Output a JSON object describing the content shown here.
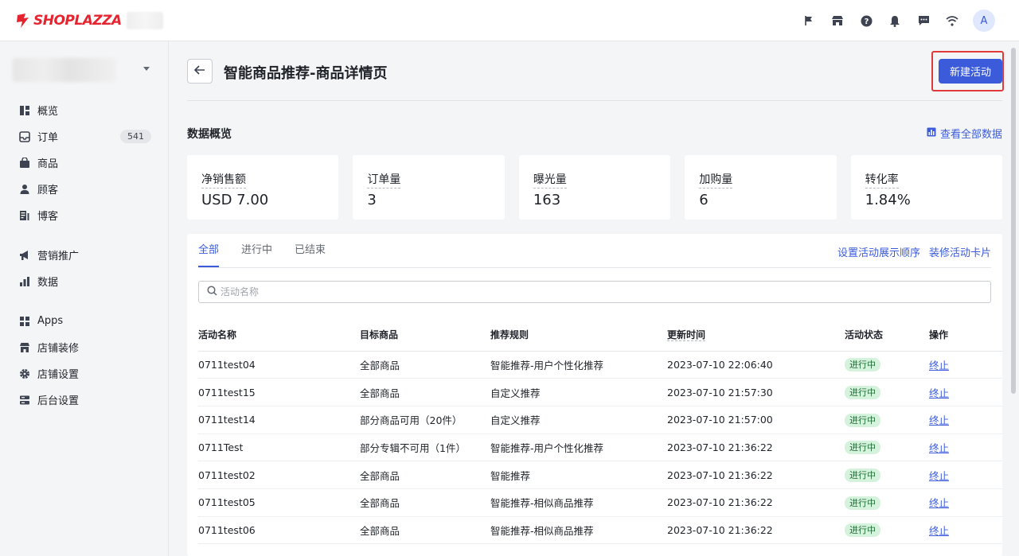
{
  "brand": {
    "name": "SHOPLAZZA",
    "color": "#e5242f"
  },
  "topbar": {
    "icons": [
      "flag-icon",
      "store-icon",
      "help-icon",
      "bell-icon",
      "message-icon",
      "wifi-icon"
    ],
    "avatar_letter": "A"
  },
  "sidebar": {
    "groups": [
      [
        {
          "icon": "overview-icon",
          "label": "概览"
        },
        {
          "icon": "order-icon",
          "label": "订单",
          "badge": "541"
        },
        {
          "icon": "product-icon",
          "label": "商品"
        },
        {
          "icon": "customer-icon",
          "label": "顾客"
        },
        {
          "icon": "blog-icon",
          "label": "博客"
        }
      ],
      [
        {
          "icon": "megaphone-icon",
          "label": "营销推广"
        },
        {
          "icon": "chart-icon",
          "label": "数据"
        }
      ],
      [
        {
          "icon": "apps-icon",
          "label": "Apps"
        },
        {
          "icon": "store-decor-icon",
          "label": "店铺装修"
        },
        {
          "icon": "gear-icon",
          "label": "店铺设置"
        },
        {
          "icon": "server-icon",
          "label": "后台设置"
        }
      ]
    ]
  },
  "header": {
    "title": "智能商品推荐-商品详情页",
    "new_button": "新建活动"
  },
  "overview": {
    "title": "数据概览",
    "view_all": "查看全部数据",
    "cards": [
      {
        "label": "净销售额",
        "value": "USD 7.00"
      },
      {
        "label": "订单量",
        "value": "3"
      },
      {
        "label": "曝光量",
        "value": "163"
      },
      {
        "label": "加购量",
        "value": "6"
      },
      {
        "label": "转化率",
        "value": "1.84%"
      }
    ]
  },
  "activities": {
    "tabs": [
      "全部",
      "进行中",
      "已结束"
    ],
    "links": [
      "设置活动展示顺序",
      "装修活动卡片"
    ],
    "search_placeholder": "活动名称",
    "columns": [
      "活动名称",
      "目标商品",
      "推荐规则",
      "更新时间",
      "活动状态",
      "操作"
    ],
    "rows": [
      [
        "0711test04",
        "全部商品",
        "智能推荐-用户个性化推荐",
        "2023-07-10 22:06:40",
        "进行中",
        "终止"
      ],
      [
        "0711test15",
        "全部商品",
        "自定义推荐",
        "2023-07-10 21:57:30",
        "进行中",
        "终止"
      ],
      [
        "0711test14",
        "部分商品可用（20件）",
        "自定义推荐",
        "2023-07-10 21:57:00",
        "进行中",
        "终止"
      ],
      [
        "0711Test",
        "部分专辑不可用（1件）",
        "智能推荐-用户个性化推荐",
        "2023-07-10 21:36:22",
        "进行中",
        "终止"
      ],
      [
        "0711test02",
        "全部商品",
        "智能推荐",
        "2023-07-10 21:36:22",
        "进行中",
        "终止"
      ],
      [
        "0711test05",
        "全部商品",
        "智能推荐-相似商品推荐",
        "2023-07-10 21:36:22",
        "进行中",
        "终止"
      ],
      [
        "0711test06",
        "全部商品",
        "智能推荐-相似商品推荐",
        "2023-07-10 21:36:22",
        "进行中",
        "终止"
      ]
    ]
  }
}
